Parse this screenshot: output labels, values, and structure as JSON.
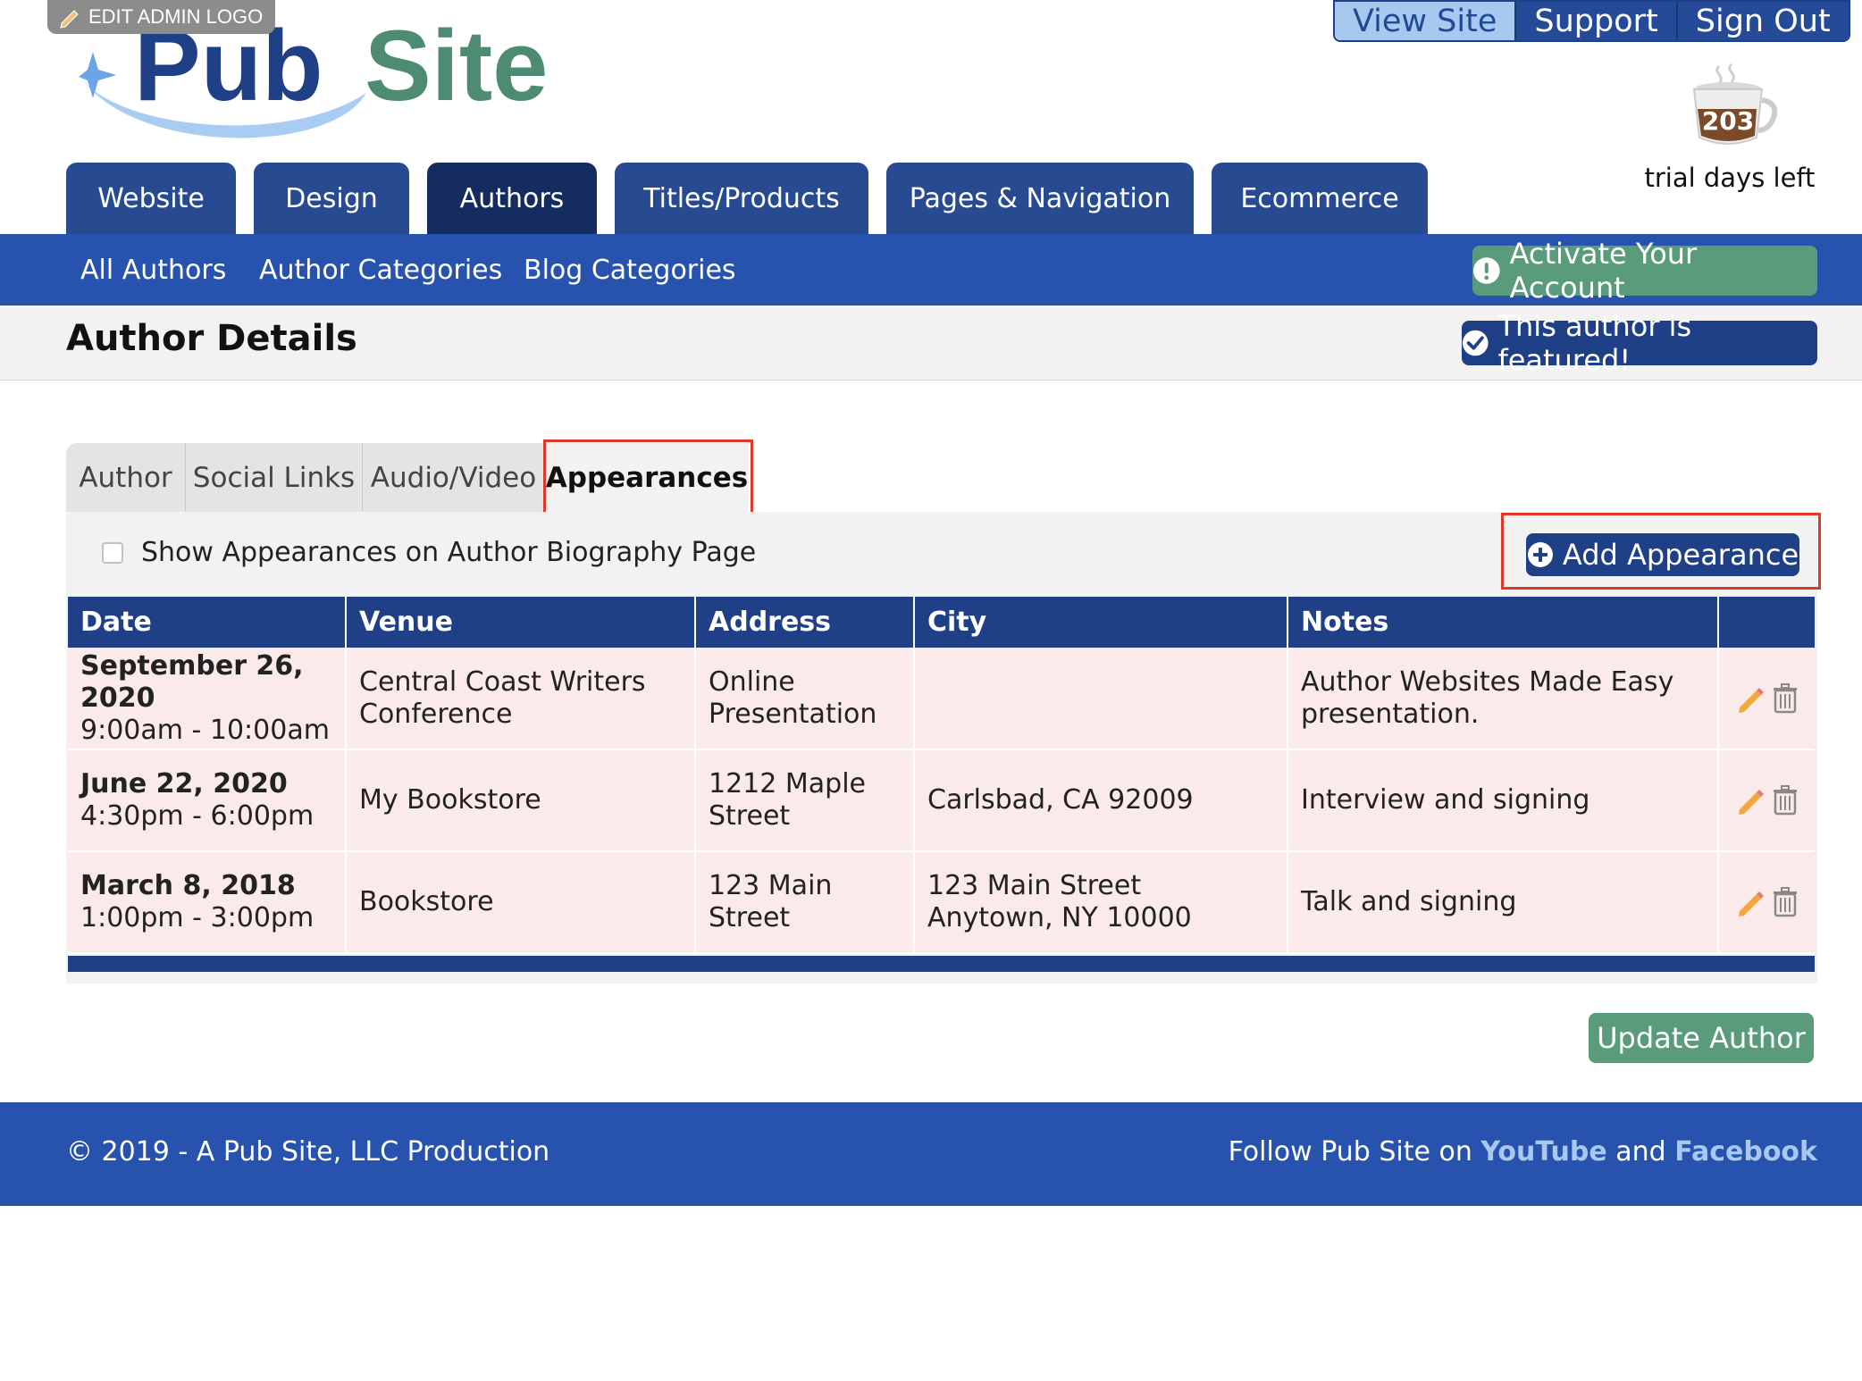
{
  "header": {
    "edit_logo_label": "EDIT ADMIN LOGO",
    "logo_part1": "Pub",
    "logo_part2": "Site",
    "top_links": [
      "View Site",
      "Support",
      "Sign Out"
    ],
    "trial_days": "203",
    "trial_label": "trial days left"
  },
  "main_tabs": [
    {
      "label": "Website"
    },
    {
      "label": "Design"
    },
    {
      "label": "Authors"
    },
    {
      "label": "Titles/Products"
    },
    {
      "label": "Pages & Navigation"
    },
    {
      "label": "Ecommerce"
    }
  ],
  "subnav": {
    "items": [
      "All Authors",
      "Author Categories",
      "Blog Categories"
    ],
    "activate_label": "Activate Your Account"
  },
  "details": {
    "title": "Author Details",
    "featured_label": "This author is featured!"
  },
  "tabs": [
    "Author",
    "Social Links",
    "Audio/Video",
    "Appearances"
  ],
  "panel": {
    "show_label": "Show Appearances on Author Biography Page",
    "add_label": "Add Appearance"
  },
  "table": {
    "headers": [
      "Date",
      "Venue",
      "Address",
      "City",
      "Notes",
      ""
    ],
    "rows": [
      {
        "date": "September 26, 2020",
        "time": "9:00am - 10:00am",
        "venue": "Central Coast Writers Conference",
        "address": "Online Presentation",
        "city": "",
        "notes": "Author Websites Made Easy presentation."
      },
      {
        "date": "June 22, 2020",
        "time": "4:30pm - 6:00pm",
        "venue": "My Bookstore",
        "address": "1212 Maple Street",
        "city": "Carlsbad, CA 92009",
        "notes": "Interview and signing"
      },
      {
        "date": "March 8, 2018",
        "time": "1:00pm - 3:00pm",
        "venue": "Bookstore",
        "address": "123 Main Street",
        "city": "123 Main Street Anytown, NY 10000",
        "notes": "Talk and signing"
      }
    ]
  },
  "update_label": "Update Author",
  "footer": {
    "copyright": "© 2019 - A Pub Site, LLC Production",
    "follow_prefix": "Follow Pub Site on ",
    "youtube": "YouTube",
    "and": " and ",
    "facebook": "Facebook"
  },
  "colors": {
    "nav_blue": "#274a91",
    "bar_blue": "#2752ad",
    "dark_blue": "#1f3f86",
    "green": "#5a9b7c",
    "row_pink": "#fbeaea",
    "highlight_red": "#e0382b"
  }
}
